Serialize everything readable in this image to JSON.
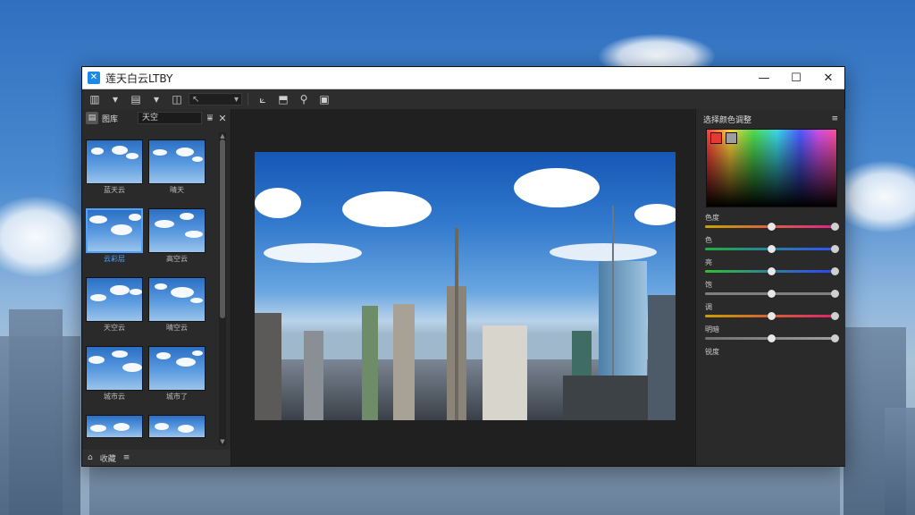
{
  "window": {
    "title": "莲天白云LTBY",
    "app_icon": "image-app-icon",
    "minimize": "—",
    "maximize": "☐",
    "close": "✕"
  },
  "toolbar": {
    "items": [
      {
        "name": "import-icon",
        "glyph": "▥"
      },
      {
        "name": "dropdown-icon",
        "glyph": "▾"
      },
      {
        "name": "layers-icon",
        "glyph": "▤"
      },
      {
        "name": "dropdown-icon",
        "glyph": "▾"
      },
      {
        "name": "frame-icon",
        "glyph": "◫"
      }
    ],
    "select_value": "↖",
    "tools": [
      {
        "name": "crop-tool-icon",
        "glyph": "⟀"
      },
      {
        "name": "transform-tool-icon",
        "glyph": "⬒"
      },
      {
        "name": "zoom-tool-icon",
        "glyph": "⚲"
      },
      {
        "name": "export-tool-icon",
        "glyph": "▣"
      }
    ]
  },
  "library": {
    "header_label": "图库",
    "filter_value": "天空",
    "close": "✕",
    "thumbs": [
      {
        "caption": "蓝天云",
        "selected": false
      },
      {
        "caption": "晴天",
        "selected": false
      },
      {
        "caption": "云彩层",
        "selected": true
      },
      {
        "caption": "高空云",
        "selected": false
      },
      {
        "caption": "天空云",
        "selected": false
      },
      {
        "caption": "晴空云",
        "selected": false
      },
      {
        "caption": "城市云",
        "selected": false
      },
      {
        "caption": "城市了",
        "selected": false
      },
      {
        "caption": "",
        "selected": false
      },
      {
        "caption": "",
        "selected": false
      }
    ],
    "footer_label": "收藏",
    "footer_home": "⌂",
    "footer_menu": "≡"
  },
  "color_panel": {
    "title": "选择颜色调整",
    "menu": "≡",
    "swatches": [
      "#e53935",
      "#9e9e9e"
    ],
    "sliders": [
      {
        "label": "色度",
        "value": 0.5,
        "colors": [
          "#c8a400",
          "#e0208c"
        ]
      },
      {
        "label": "色",
        "value": 0.5,
        "colors": [
          "#20b040",
          "#3050ff"
        ]
      },
      {
        "label": "亮",
        "value": 0.5,
        "colors": [
          "#30c030",
          "#3040ff"
        ]
      },
      {
        "label": "饱",
        "value": 0.5,
        "colors": [
          "#808080",
          "#808080"
        ]
      },
      {
        "label": "调",
        "value": 0.5,
        "colors": [
          "#c8a000",
          "#e02070"
        ]
      },
      {
        "label": "明暗",
        "value": 0.5,
        "colors": [
          "#707070",
          "#a0a0a0"
        ]
      },
      {
        "label": "锐度",
        "value": null,
        "colors": [
          "#2a2a2a",
          "#2a2a2a"
        ]
      }
    ]
  }
}
